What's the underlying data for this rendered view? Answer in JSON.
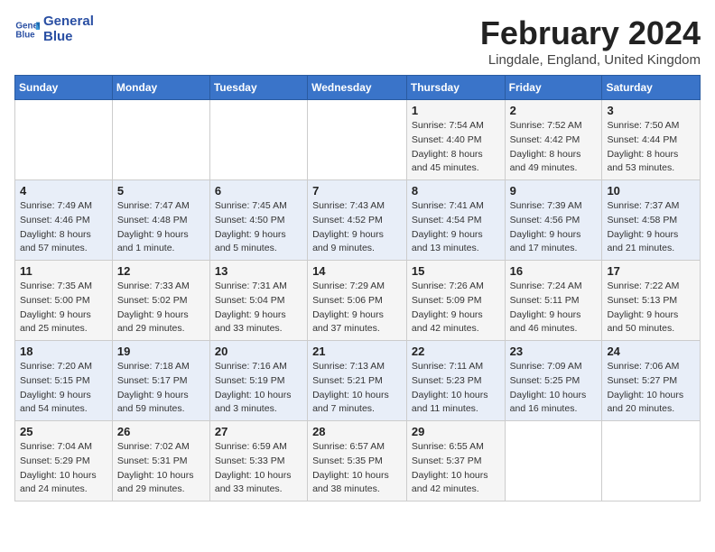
{
  "header": {
    "logo_line1": "General",
    "logo_line2": "Blue",
    "month_year": "February 2024",
    "location": "Lingdale, England, United Kingdom"
  },
  "days_of_week": [
    "Sunday",
    "Monday",
    "Tuesday",
    "Wednesday",
    "Thursday",
    "Friday",
    "Saturday"
  ],
  "weeks": [
    [
      {
        "day": "",
        "info": ""
      },
      {
        "day": "",
        "info": ""
      },
      {
        "day": "",
        "info": ""
      },
      {
        "day": "",
        "info": ""
      },
      {
        "day": "1",
        "info": "Sunrise: 7:54 AM\nSunset: 4:40 PM\nDaylight: 8 hours\nand 45 minutes."
      },
      {
        "day": "2",
        "info": "Sunrise: 7:52 AM\nSunset: 4:42 PM\nDaylight: 8 hours\nand 49 minutes."
      },
      {
        "day": "3",
        "info": "Sunrise: 7:50 AM\nSunset: 4:44 PM\nDaylight: 8 hours\nand 53 minutes."
      }
    ],
    [
      {
        "day": "4",
        "info": "Sunrise: 7:49 AM\nSunset: 4:46 PM\nDaylight: 8 hours\nand 57 minutes."
      },
      {
        "day": "5",
        "info": "Sunrise: 7:47 AM\nSunset: 4:48 PM\nDaylight: 9 hours\nand 1 minute."
      },
      {
        "day": "6",
        "info": "Sunrise: 7:45 AM\nSunset: 4:50 PM\nDaylight: 9 hours\nand 5 minutes."
      },
      {
        "day": "7",
        "info": "Sunrise: 7:43 AM\nSunset: 4:52 PM\nDaylight: 9 hours\nand 9 minutes."
      },
      {
        "day": "8",
        "info": "Sunrise: 7:41 AM\nSunset: 4:54 PM\nDaylight: 9 hours\nand 13 minutes."
      },
      {
        "day": "9",
        "info": "Sunrise: 7:39 AM\nSunset: 4:56 PM\nDaylight: 9 hours\nand 17 minutes."
      },
      {
        "day": "10",
        "info": "Sunrise: 7:37 AM\nSunset: 4:58 PM\nDaylight: 9 hours\nand 21 minutes."
      }
    ],
    [
      {
        "day": "11",
        "info": "Sunrise: 7:35 AM\nSunset: 5:00 PM\nDaylight: 9 hours\nand 25 minutes."
      },
      {
        "day": "12",
        "info": "Sunrise: 7:33 AM\nSunset: 5:02 PM\nDaylight: 9 hours\nand 29 minutes."
      },
      {
        "day": "13",
        "info": "Sunrise: 7:31 AM\nSunset: 5:04 PM\nDaylight: 9 hours\nand 33 minutes."
      },
      {
        "day": "14",
        "info": "Sunrise: 7:29 AM\nSunset: 5:06 PM\nDaylight: 9 hours\nand 37 minutes."
      },
      {
        "day": "15",
        "info": "Sunrise: 7:26 AM\nSunset: 5:09 PM\nDaylight: 9 hours\nand 42 minutes."
      },
      {
        "day": "16",
        "info": "Sunrise: 7:24 AM\nSunset: 5:11 PM\nDaylight: 9 hours\nand 46 minutes."
      },
      {
        "day": "17",
        "info": "Sunrise: 7:22 AM\nSunset: 5:13 PM\nDaylight: 9 hours\nand 50 minutes."
      }
    ],
    [
      {
        "day": "18",
        "info": "Sunrise: 7:20 AM\nSunset: 5:15 PM\nDaylight: 9 hours\nand 54 minutes."
      },
      {
        "day": "19",
        "info": "Sunrise: 7:18 AM\nSunset: 5:17 PM\nDaylight: 9 hours\nand 59 minutes."
      },
      {
        "day": "20",
        "info": "Sunrise: 7:16 AM\nSunset: 5:19 PM\nDaylight: 10 hours\nand 3 minutes."
      },
      {
        "day": "21",
        "info": "Sunrise: 7:13 AM\nSunset: 5:21 PM\nDaylight: 10 hours\nand 7 minutes."
      },
      {
        "day": "22",
        "info": "Sunrise: 7:11 AM\nSunset: 5:23 PM\nDaylight: 10 hours\nand 11 minutes."
      },
      {
        "day": "23",
        "info": "Sunrise: 7:09 AM\nSunset: 5:25 PM\nDaylight: 10 hours\nand 16 minutes."
      },
      {
        "day": "24",
        "info": "Sunrise: 7:06 AM\nSunset: 5:27 PM\nDaylight: 10 hours\nand 20 minutes."
      }
    ],
    [
      {
        "day": "25",
        "info": "Sunrise: 7:04 AM\nSunset: 5:29 PM\nDaylight: 10 hours\nand 24 minutes."
      },
      {
        "day": "26",
        "info": "Sunrise: 7:02 AM\nSunset: 5:31 PM\nDaylight: 10 hours\nand 29 minutes."
      },
      {
        "day": "27",
        "info": "Sunrise: 6:59 AM\nSunset: 5:33 PM\nDaylight: 10 hours\nand 33 minutes."
      },
      {
        "day": "28",
        "info": "Sunrise: 6:57 AM\nSunset: 5:35 PM\nDaylight: 10 hours\nand 38 minutes."
      },
      {
        "day": "29",
        "info": "Sunrise: 6:55 AM\nSunset: 5:37 PM\nDaylight: 10 hours\nand 42 minutes."
      },
      {
        "day": "",
        "info": ""
      },
      {
        "day": "",
        "info": ""
      }
    ]
  ]
}
